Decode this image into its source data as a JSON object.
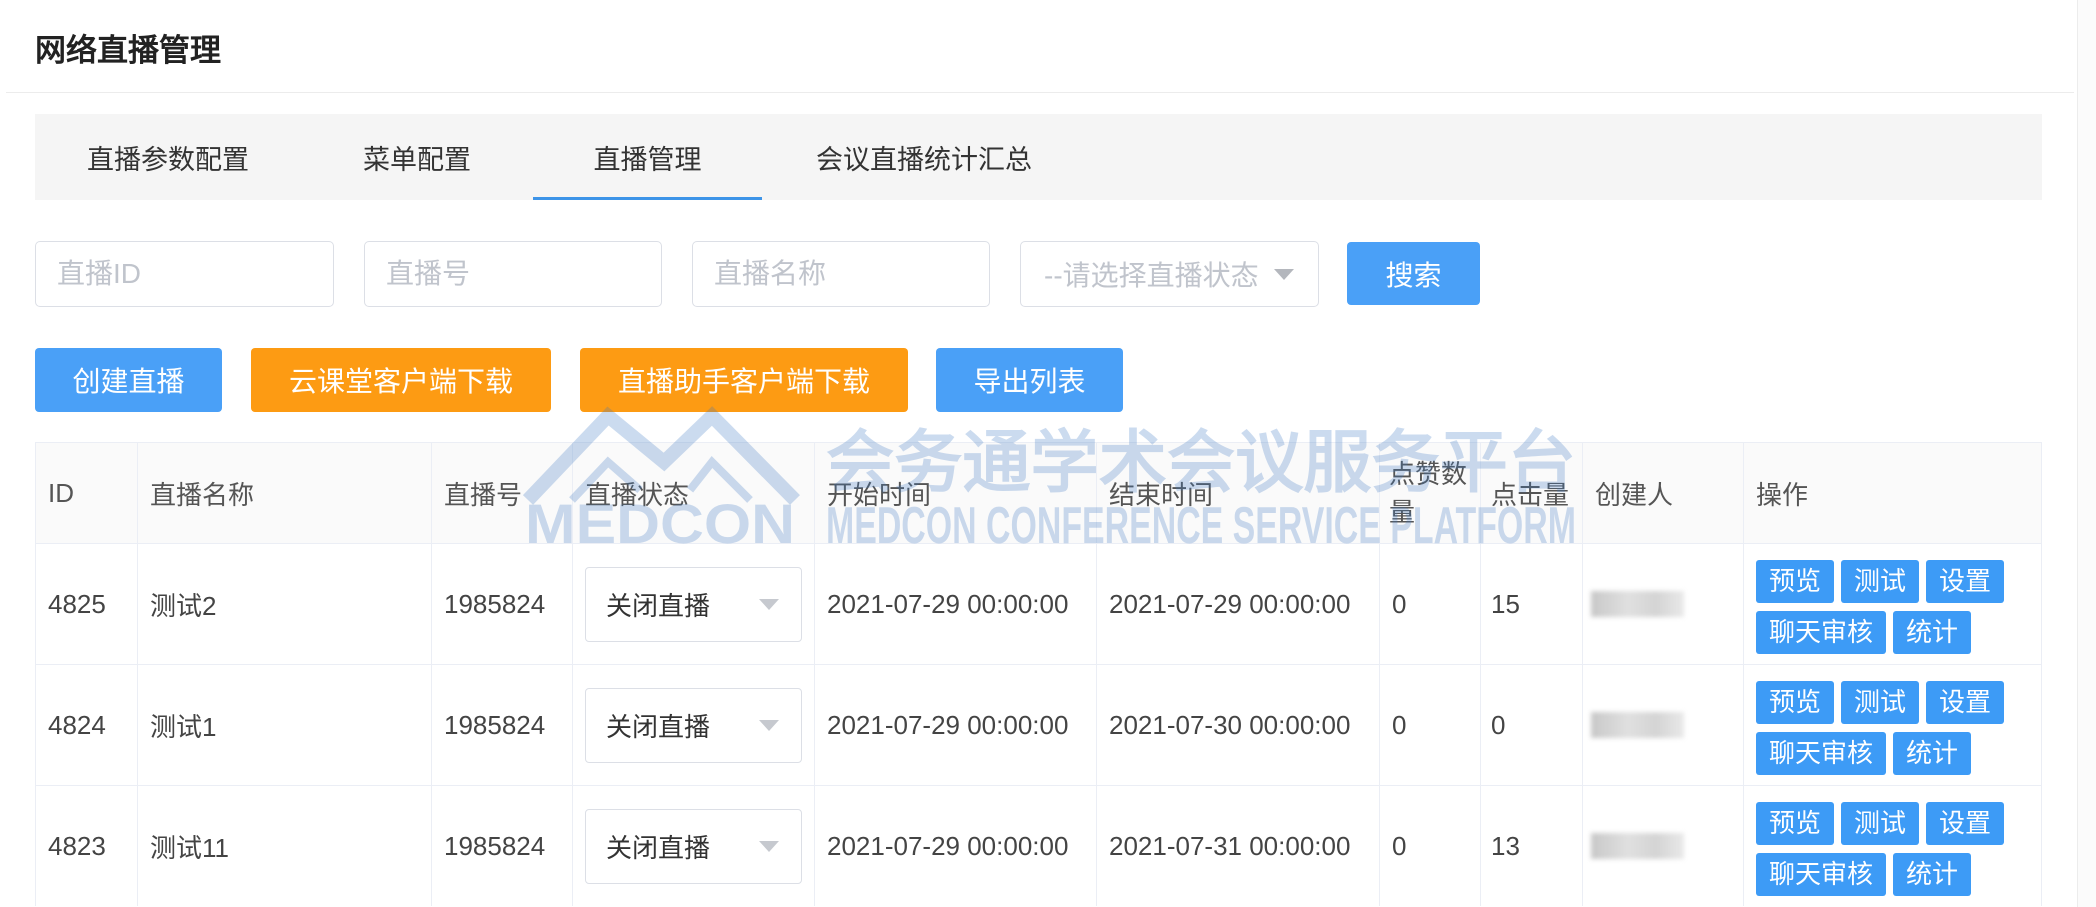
{
  "page_title": "网络直播管理",
  "colors": {
    "primary": "#4aa0f7",
    "warning": "#fd9b13",
    "tab_active": "#3d94e8",
    "row_action": "#3d9bf6",
    "watermark": "#3c78c3"
  },
  "tabs": [
    {
      "label": "直播参数配置",
      "active": false
    },
    {
      "label": "菜单配置",
      "active": false
    },
    {
      "label": "直播管理",
      "active": true
    },
    {
      "label": "会议直播统计汇总",
      "active": false
    }
  ],
  "search": {
    "live_id_placeholder": "直播ID",
    "live_no_placeholder": "直播号",
    "live_name_placeholder": "直播名称",
    "status_placeholder": "--请选择直播状态",
    "search_label": "搜索"
  },
  "toolbar": {
    "create_label": "创建直播",
    "cloud_classroom_download_label": "云课堂客户端下载",
    "live_assistant_download_label": "直播助手客户端下载",
    "export_label": "导出列表"
  },
  "table": {
    "headers": [
      "ID",
      "直播名称",
      "直播号",
      "直播状态",
      "开始时间",
      "结束时间",
      "点赞数量",
      "点击量",
      "创建人",
      "操作"
    ],
    "row_actions": [
      "预览",
      "测试",
      "设置",
      "聊天审核",
      "统计"
    ],
    "rows": [
      {
        "id": "4825",
        "name": "测试2",
        "live_no": "1985824",
        "status": "关闭直播",
        "start_time": "2021-07-29 00:00:00",
        "end_time": "2021-07-29 00:00:00",
        "likes": "0",
        "clicks": "15"
      },
      {
        "id": "4824",
        "name": "测试1",
        "live_no": "1985824",
        "status": "关闭直播",
        "start_time": "2021-07-29 00:00:00",
        "end_time": "2021-07-30 00:00:00",
        "likes": "0",
        "clicks": "0"
      },
      {
        "id": "4823",
        "name": "测试11",
        "live_no": "1985824",
        "status": "关闭直播",
        "start_time": "2021-07-29 00:00:00",
        "end_time": "2021-07-31 00:00:00",
        "likes": "0",
        "clicks": "13"
      }
    ]
  },
  "watermark": {
    "brand": "MEDCON",
    "cn": "会务通学术会议服务平台",
    "en": "MEDCON CONFERENCE SERVICE PLATFORM"
  }
}
